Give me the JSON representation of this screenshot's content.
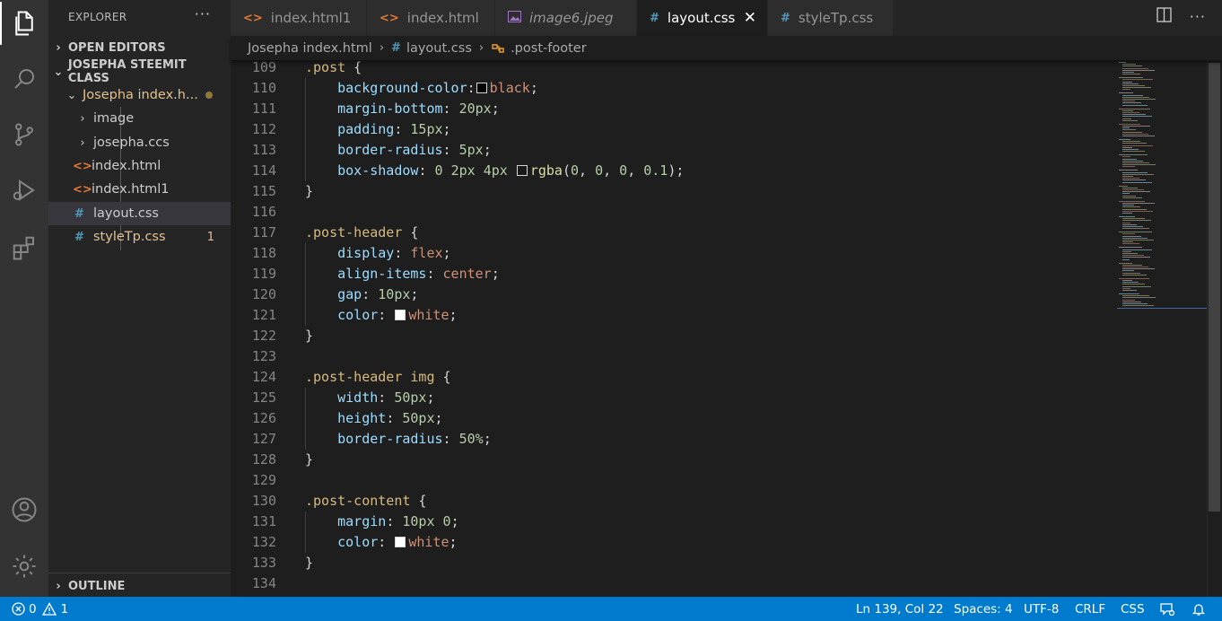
{
  "activity_bar": {
    "items": [
      {
        "name": "explorer",
        "icon": "files-icon",
        "active": true
      },
      {
        "name": "search",
        "icon": "search-icon"
      },
      {
        "name": "source-control",
        "icon": "source-control-icon"
      },
      {
        "name": "run-debug",
        "icon": "run-debug-icon"
      },
      {
        "name": "extensions",
        "icon": "extensions-icon"
      }
    ],
    "bottom": [
      {
        "name": "accounts",
        "icon": "account-icon"
      },
      {
        "name": "manage",
        "icon": "gear-icon"
      }
    ]
  },
  "sidebar": {
    "title": "EXPLORER",
    "more": "···",
    "open_editors": "OPEN EDITORS",
    "workspace": "JOSEPHA STEEMIT CLASS",
    "outline": "OUTLINE",
    "tree": [
      {
        "label": "Josepha index.h...",
        "type": "folder",
        "expanded": true,
        "color": "#e2c08d",
        "modified": true
      },
      {
        "label": "image",
        "type": "folder",
        "expanded": false
      },
      {
        "label": "josepha.ccs",
        "type": "folder",
        "expanded": false
      },
      {
        "label": "index.html",
        "type": "html",
        "icon": "<>"
      },
      {
        "label": "index.html1",
        "type": "html",
        "icon": "<>"
      },
      {
        "label": "layout.css",
        "type": "css",
        "icon": "#",
        "selected": true
      },
      {
        "label": "styleTp.css",
        "type": "css",
        "icon": "#",
        "color": "#e2c08d",
        "badge": "1"
      }
    ]
  },
  "tabs": [
    {
      "label": "index.html1",
      "icon": "<>"
    },
    {
      "label": "index.html",
      "icon": "<>"
    },
    {
      "label": "image6.jpeg",
      "icon": "image-icon",
      "italic": true
    },
    {
      "label": "layout.css",
      "icon": "#",
      "active": true,
      "close": "✕"
    },
    {
      "label": "styleTp.css",
      "icon": "#"
    }
  ],
  "breadcrumb": {
    "folder": "Josepha index.html",
    "file": "layout.css",
    "symbol": ".post-footer"
  },
  "code_lines": [
    {
      "n": "109",
      "tokens": [
        [
          "sel",
          ".post"
        ],
        [
          "punc",
          " {"
        ]
      ]
    },
    {
      "n": "110",
      "tokens": [
        [
          "punc",
          "    "
        ],
        [
          "prop",
          "background-color"
        ],
        [
          "punc",
          ":"
        ],
        [
          "swatch",
          "#000000"
        ],
        [
          "val",
          "black"
        ],
        [
          "punc",
          ";"
        ]
      ]
    },
    {
      "n": "111",
      "tokens": [
        [
          "punc",
          "    "
        ],
        [
          "prop",
          "margin-bottom"
        ],
        [
          "punc",
          ": "
        ],
        [
          "num",
          "20px"
        ],
        [
          "punc",
          ";"
        ]
      ]
    },
    {
      "n": "112",
      "tokens": [
        [
          "punc",
          "    "
        ],
        [
          "prop",
          "padding"
        ],
        [
          "punc",
          ": "
        ],
        [
          "num",
          "15px"
        ],
        [
          "punc",
          ";"
        ]
      ]
    },
    {
      "n": "113",
      "tokens": [
        [
          "punc",
          "    "
        ],
        [
          "prop",
          "border-radius"
        ],
        [
          "punc",
          ": "
        ],
        [
          "num",
          "5px"
        ],
        [
          "punc",
          ";"
        ]
      ]
    },
    {
      "n": "114",
      "tokens": [
        [
          "punc",
          "    "
        ],
        [
          "prop",
          "box-shadow"
        ],
        [
          "punc",
          ": "
        ],
        [
          "num",
          "0"
        ],
        [
          "punc",
          " "
        ],
        [
          "num",
          "2px"
        ],
        [
          "punc",
          " "
        ],
        [
          "num",
          "4px"
        ],
        [
          "punc",
          " "
        ],
        [
          "swatch",
          "rgba(0,0,0,0.1)"
        ],
        [
          "func",
          "rgba"
        ],
        [
          "punc",
          "("
        ],
        [
          "num",
          "0"
        ],
        [
          "punc",
          ", "
        ],
        [
          "num",
          "0"
        ],
        [
          "punc",
          ", "
        ],
        [
          "num",
          "0"
        ],
        [
          "punc",
          ", "
        ],
        [
          "num",
          "0.1"
        ],
        [
          "punc",
          ");"
        ]
      ]
    },
    {
      "n": "115",
      "tokens": [
        [
          "punc",
          "}"
        ]
      ]
    },
    {
      "n": "116",
      "tokens": []
    },
    {
      "n": "117",
      "tokens": [
        [
          "sel",
          ".post-header"
        ],
        [
          "punc",
          " {"
        ]
      ]
    },
    {
      "n": "118",
      "tokens": [
        [
          "punc",
          "    "
        ],
        [
          "prop",
          "display"
        ],
        [
          "punc",
          ": "
        ],
        [
          "val",
          "flex"
        ],
        [
          "punc",
          ";"
        ]
      ]
    },
    {
      "n": "119",
      "tokens": [
        [
          "punc",
          "    "
        ],
        [
          "prop",
          "align-items"
        ],
        [
          "punc",
          ": "
        ],
        [
          "val",
          "center"
        ],
        [
          "punc",
          ";"
        ]
      ]
    },
    {
      "n": "120",
      "tokens": [
        [
          "punc",
          "    "
        ],
        [
          "prop",
          "gap"
        ],
        [
          "punc",
          ": "
        ],
        [
          "num",
          "10px"
        ],
        [
          "punc",
          ";"
        ]
      ]
    },
    {
      "n": "121",
      "tokens": [
        [
          "punc",
          "    "
        ],
        [
          "prop",
          "color"
        ],
        [
          "punc",
          ": "
        ],
        [
          "swatch",
          "#ffffff"
        ],
        [
          "val",
          "white"
        ],
        [
          "punc",
          ";"
        ]
      ]
    },
    {
      "n": "122",
      "tokens": [
        [
          "punc",
          "}"
        ]
      ]
    },
    {
      "n": "123",
      "tokens": []
    },
    {
      "n": "124",
      "tokens": [
        [
          "sel",
          ".post-header img"
        ],
        [
          "punc",
          " {"
        ]
      ]
    },
    {
      "n": "125",
      "tokens": [
        [
          "punc",
          "    "
        ],
        [
          "prop",
          "width"
        ],
        [
          "punc",
          ": "
        ],
        [
          "num",
          "50px"
        ],
        [
          "punc",
          ";"
        ]
      ]
    },
    {
      "n": "126",
      "tokens": [
        [
          "punc",
          "    "
        ],
        [
          "prop",
          "height"
        ],
        [
          "punc",
          ": "
        ],
        [
          "num",
          "50px"
        ],
        [
          "punc",
          ";"
        ]
      ]
    },
    {
      "n": "127",
      "tokens": [
        [
          "punc",
          "    "
        ],
        [
          "prop",
          "border-radius"
        ],
        [
          "punc",
          ": "
        ],
        [
          "num",
          "50%"
        ],
        [
          "punc",
          ";"
        ]
      ]
    },
    {
      "n": "128",
      "tokens": [
        [
          "punc",
          "}"
        ]
      ]
    },
    {
      "n": "129",
      "tokens": []
    },
    {
      "n": "130",
      "tokens": [
        [
          "sel",
          ".post-content"
        ],
        [
          "punc",
          " {"
        ]
      ]
    },
    {
      "n": "131",
      "tokens": [
        [
          "punc",
          "    "
        ],
        [
          "prop",
          "margin"
        ],
        [
          "punc",
          ": "
        ],
        [
          "num",
          "10px"
        ],
        [
          "punc",
          " "
        ],
        [
          "num",
          "0"
        ],
        [
          "punc",
          ";"
        ]
      ]
    },
    {
      "n": "132",
      "tokens": [
        [
          "punc",
          "    "
        ],
        [
          "prop",
          "color"
        ],
        [
          "punc",
          ": "
        ],
        [
          "swatch",
          "#ffffff"
        ],
        [
          "val",
          "white"
        ],
        [
          "punc",
          ";"
        ]
      ]
    },
    {
      "n": "133",
      "tokens": [
        [
          "punc",
          "}"
        ]
      ]
    },
    {
      "n": "134",
      "tokens": []
    }
  ],
  "statusbar": {
    "errors": "0",
    "warnings": "1",
    "position": "Ln 139, Col 22",
    "spaces": "Spaces: 4",
    "encoding": "UTF-8",
    "eol": "CRLF",
    "language": "CSS"
  },
  "colors": {
    "accent": "#007acc",
    "modified": "#e2c08d",
    "html_icon": "#e37933",
    "css_icon": "#519aba",
    "image_icon": "#a074c4"
  }
}
